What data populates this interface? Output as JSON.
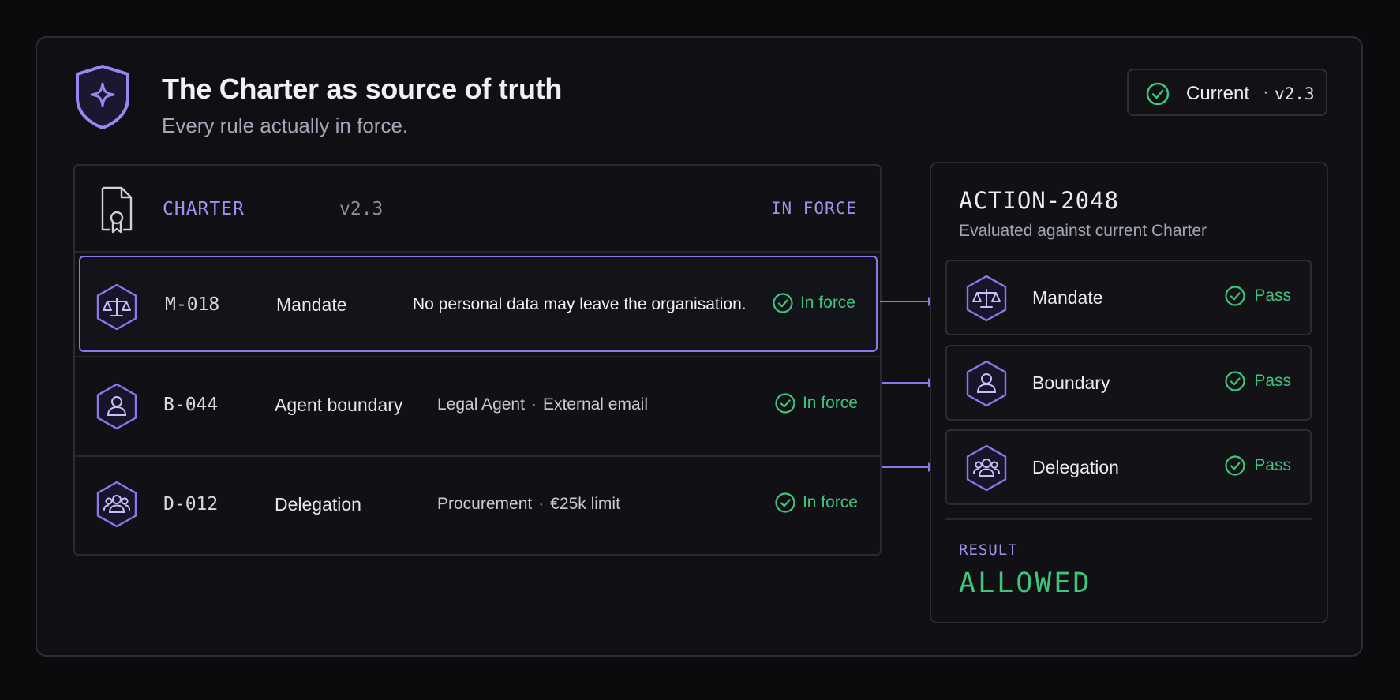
{
  "header": {
    "title": "The Charter as source of truth",
    "subtitle": "Every rule actually in force.",
    "logo_icon": "shield-sparkle-icon"
  },
  "version_pill": {
    "label": "Current",
    "separator": "·",
    "version": "v2.3"
  },
  "charter": {
    "name": "CHARTER",
    "version": "v2.3",
    "status": "IN FORCE",
    "icon": "certificate-document-icon",
    "rules": [
      {
        "code": "M-018",
        "type": "Mandate",
        "description": "No personal data may leave the organisation.",
        "description_parts": [],
        "status": "In force",
        "icon": "scales-icon",
        "selected": true
      },
      {
        "code": "B-044",
        "type": "Agent boundary",
        "description": "",
        "description_parts": [
          "Legal Agent",
          "External email"
        ],
        "status": "In force",
        "icon": "person-icon",
        "selected": false
      },
      {
        "code": "D-012",
        "type": "Delegation",
        "description": "",
        "description_parts": [
          "Procurement",
          "€25k limit"
        ],
        "status": "In force",
        "icon": "group-icon",
        "selected": false
      }
    ]
  },
  "action": {
    "id": "ACTION-2048",
    "subtitle": "Evaluated against current Charter",
    "checks": [
      {
        "label": "Mandate",
        "status": "Pass",
        "icon": "scales-icon"
      },
      {
        "label": "Boundary",
        "status": "Pass",
        "icon": "person-icon"
      },
      {
        "label": "Delegation",
        "status": "Pass",
        "icon": "group-icon"
      }
    ],
    "result_label": "RESULT",
    "result_value": "ALLOWED"
  },
  "colors": {
    "background": "#0b0b0e",
    "accent": "#8b78ec",
    "accent_text": "#a391f2",
    "success": "#3ec77c"
  }
}
